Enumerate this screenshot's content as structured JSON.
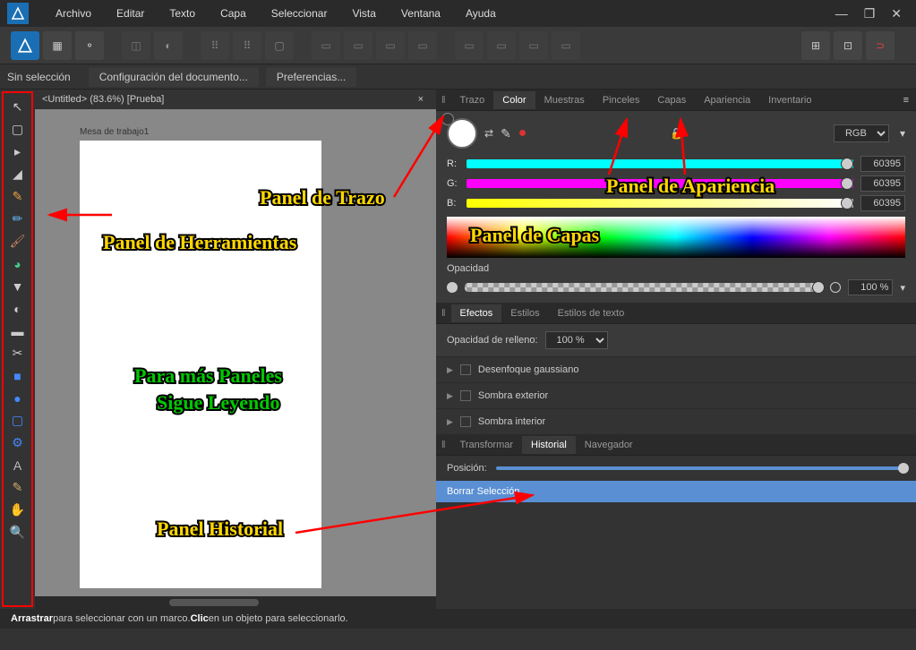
{
  "menu": {
    "items": [
      "Archivo",
      "Editar",
      "Texto",
      "Capa",
      "Seleccionar",
      "Vista",
      "Ventana",
      "Ayuda"
    ]
  },
  "context": {
    "no_sel": "Sin selección",
    "doc_config": "Configuración del documento...",
    "prefs": "Preferencias..."
  },
  "doc": {
    "title": "<Untitled> (83.6%) [Prueba]",
    "artboard": "Mesa de trabajo1"
  },
  "panel_tabs_top": [
    "Trazo",
    "Color",
    "Muestras",
    "Pinceles",
    "Capas",
    "Apariencia",
    "Inventario"
  ],
  "color": {
    "mode": "RGB",
    "r_label": "R:",
    "g_label": "G:",
    "b_label": "B:",
    "r_val": "60395",
    "g_val": "60395",
    "b_val": "60395",
    "opacity_label": "Opacidad",
    "opacity_val": "100 %"
  },
  "fx_tabs": [
    "Efectos",
    "Estilos",
    "Estilos de texto"
  ],
  "fx": {
    "fill_opacity_label": "Opacidad de relleno:",
    "fill_opacity_val": "100 %",
    "items": [
      "Desenfoque gaussiano",
      "Sombra exterior",
      "Sombra interior"
    ]
  },
  "hist_tabs": [
    "Transformar",
    "Historial",
    "Navegador"
  ],
  "history": {
    "position_label": "Posición:",
    "item": "Borrar Selección"
  },
  "status": {
    "drag": "Arrastrar",
    "drag_txt": " para seleccionar con un marco. ",
    "click": "Clic",
    "click_txt": " en un objeto para seleccionarlo."
  },
  "annotations": {
    "trazo": "Panel de Trazo",
    "herramientas": "Panel de Herramientas",
    "apariencia": "Panel de Apariencia",
    "capas": "Panel de Capas",
    "more1": "Para más Paneles",
    "more2": "Sigue Leyendo",
    "historial": "Panel Historial"
  }
}
